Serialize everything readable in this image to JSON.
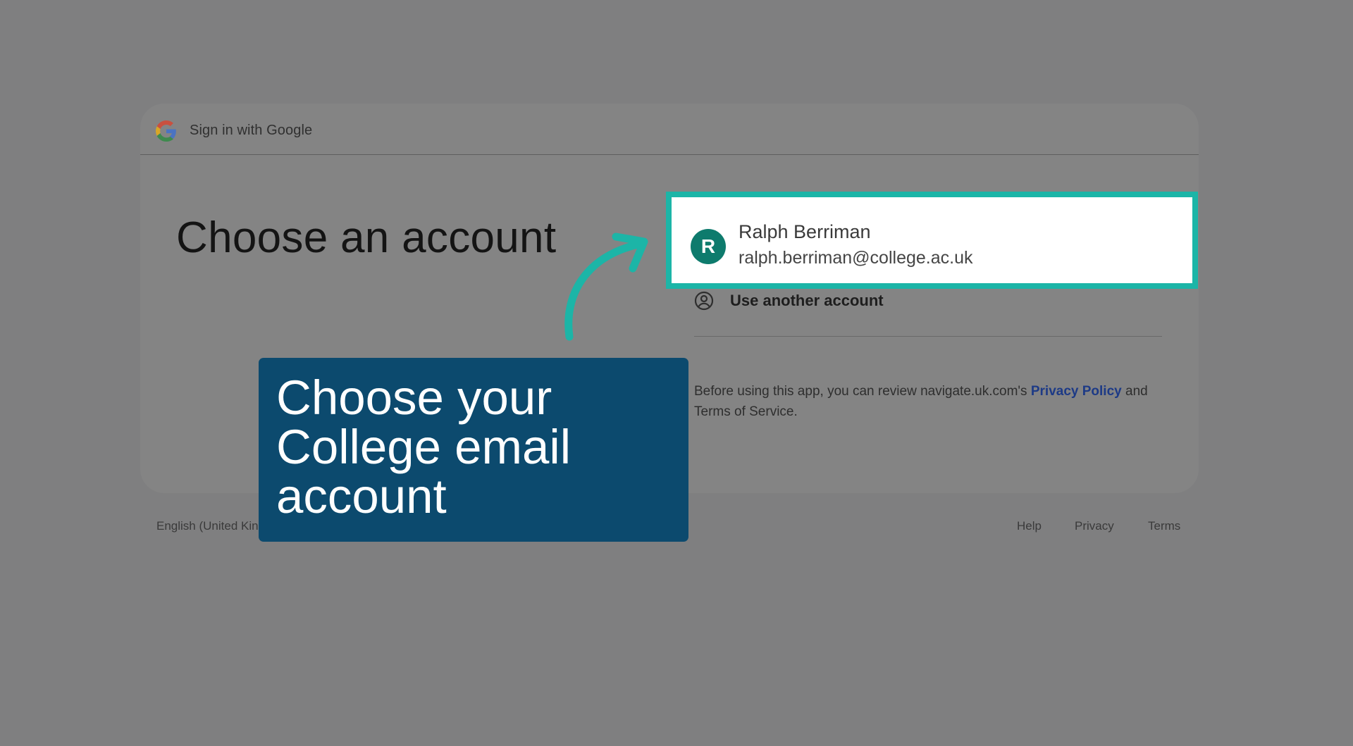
{
  "header": {
    "title": "Sign in with Google"
  },
  "page_title": "Choose an account",
  "account": {
    "initial": "R",
    "name": "Ralph Berriman",
    "email": "ralph.berriman@college.ac.uk"
  },
  "another_account_label": "Use another account",
  "disclaimer": {
    "text_before": "Before using this app, you can review navigate.uk.com's ",
    "privacy_link": "Privacy Policy",
    "text_after": " and Terms of Service."
  },
  "footer": {
    "language": "English (United Kingdom)",
    "help": "Help",
    "privacy": "Privacy",
    "terms": "Terms"
  },
  "callout": {
    "text": "Choose your College email account"
  },
  "colors": {
    "highlight": "#1cb5a7",
    "callout_bg": "#0c4a6e",
    "avatar_bg": "#0e7b6d",
    "link": "#1d3a86"
  },
  "icons": {
    "logo": "google-g-icon",
    "another": "account-circle-icon",
    "pointer": "curved-arrow-icon"
  }
}
